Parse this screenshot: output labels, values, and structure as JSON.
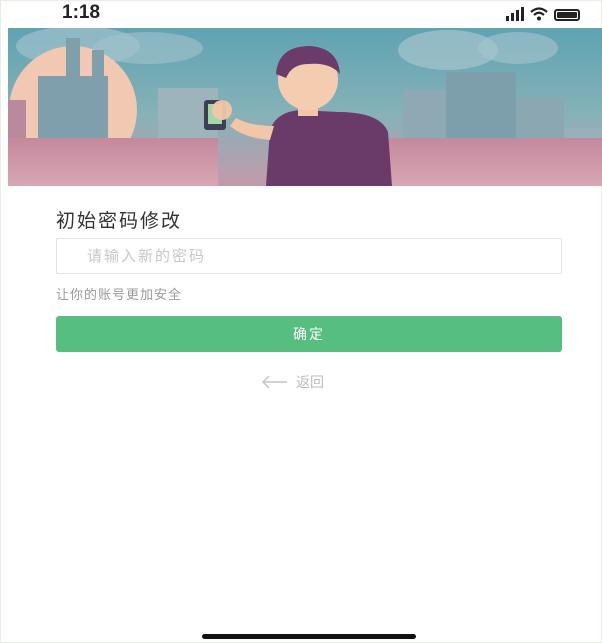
{
  "status_bar": {
    "time": "1:18",
    "icons": [
      "signal-icon",
      "wifi-icon",
      "battery-icon"
    ]
  },
  "banner": {
    "description_icon": "city-illustration"
  },
  "form": {
    "title": "初始密码修改",
    "password_placeholder": "请输入新的密码",
    "password_value": "",
    "hint": "让你的账号更加安全",
    "confirm_label": "确定"
  },
  "back": {
    "label": "返回",
    "icon": "arrow-left-icon"
  },
  "colors": {
    "accent": "#56bf80",
    "hint_text": "#9a9a9a",
    "placeholder": "#c8c8c8"
  }
}
